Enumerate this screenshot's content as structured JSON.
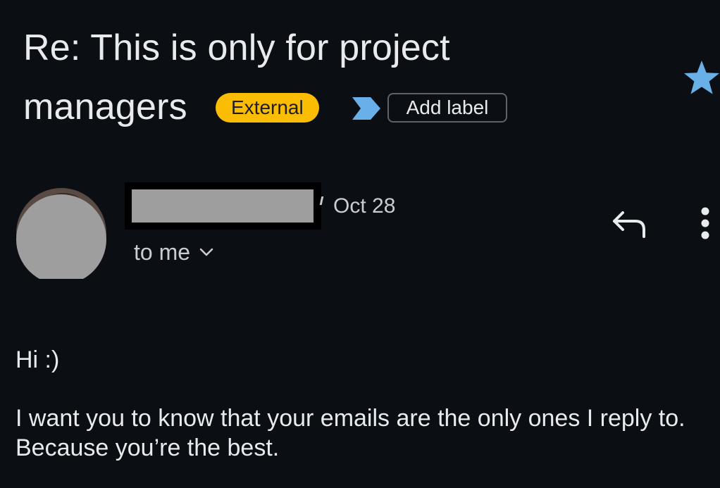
{
  "email": {
    "subject_line1": "Re: This is only for project",
    "subject_line2": "managers",
    "external_badge": "External",
    "add_label": "Add label",
    "date": "Oct 28",
    "recipient": "to me",
    "greeting": "Hi :)",
    "body": "I want you to know that your emails are the only ones I reply to. Because you’re the best."
  },
  "icons": {
    "star": "star-icon",
    "label_arrow": "label-arrow-icon",
    "reply": "reply-icon",
    "more": "more-vert-icon",
    "chevron": "chevron-down-icon",
    "avatar": "avatar"
  },
  "colors": {
    "background": "#0b0f14",
    "external_badge": "#fbbc04",
    "star": "#6ab0e8",
    "label_arrow": "#6ab0e8",
    "redaction": "#9e9e9e"
  }
}
